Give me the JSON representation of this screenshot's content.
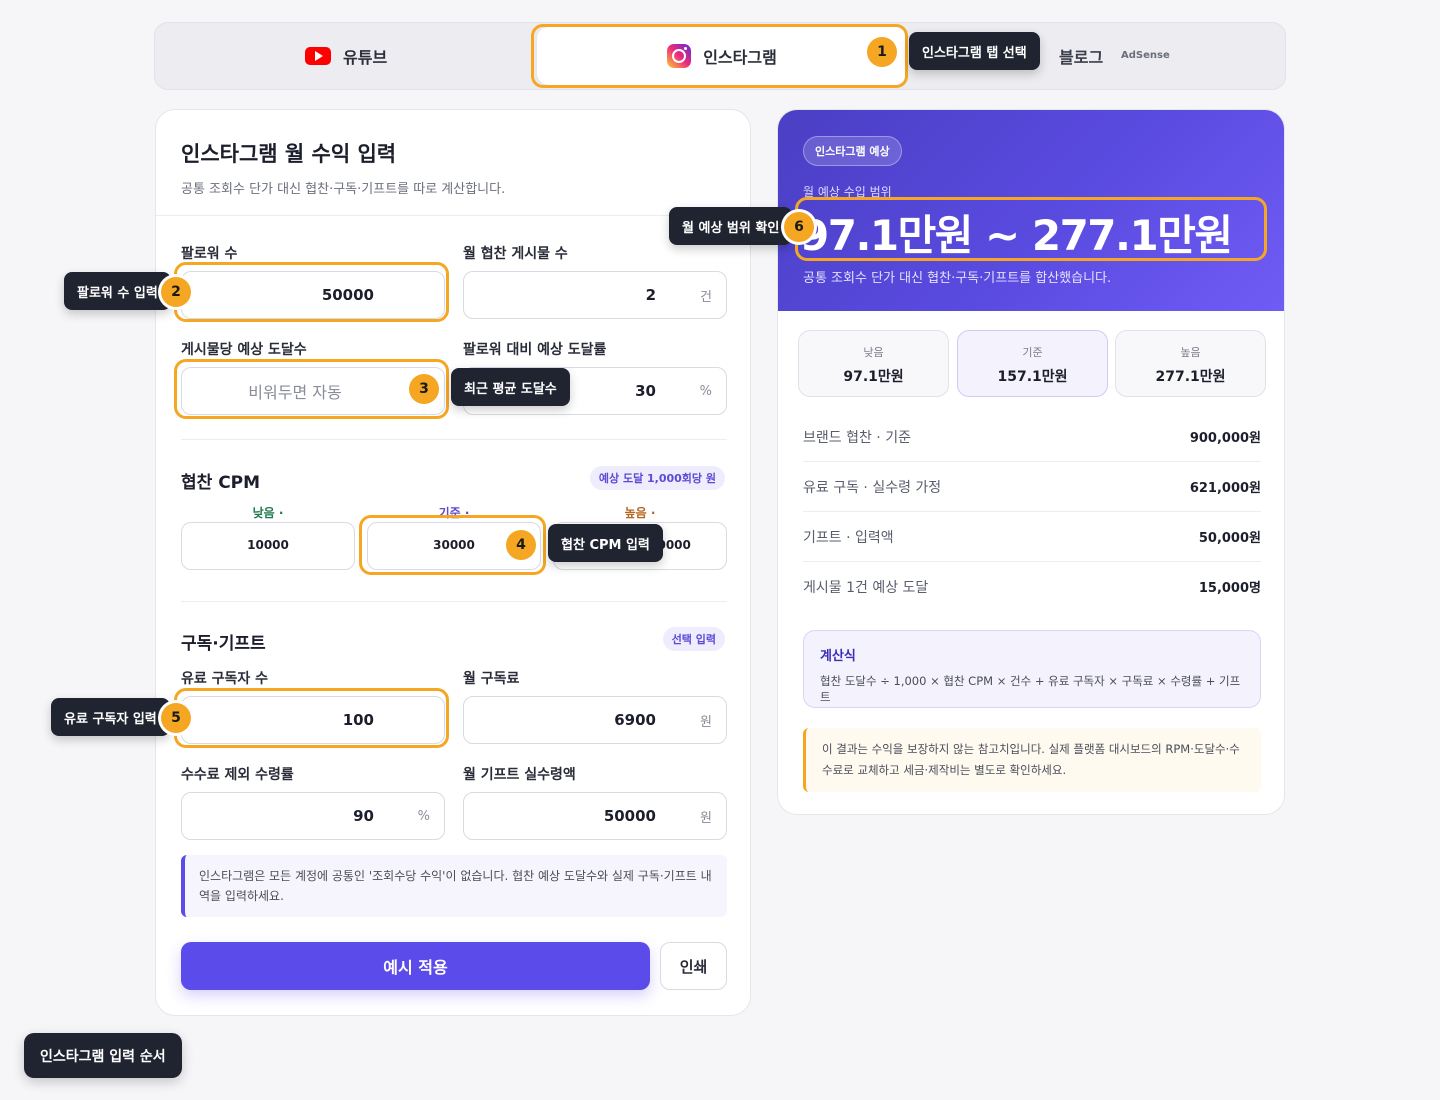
{
  "tabs": {
    "youtube": "유튜브",
    "instagram": "인스타그램",
    "blog": "블로그",
    "adsense": "AdSense"
  },
  "form": {
    "title": "인스타그램 월 수익 입력",
    "subtitle": "공통 조회수 단가 대신 협찬·구독·기프트를 따로 계산합니다.",
    "followers": {
      "label": "팔로워 수",
      "value": "50000"
    },
    "sponsored_posts": {
      "label": "월 협찬 게시물 수",
      "value": "2",
      "unit": "건"
    },
    "reach_per_post": {
      "label": "게시물당 예상 도달수",
      "placeholder": "비워두면 자동"
    },
    "reach_rate": {
      "label": "팔로워 대비 예상 도달률",
      "value": "30",
      "unit": "%"
    },
    "cpm": {
      "title": "협찬 CPM",
      "badge": "예상 도달 1,000회당 원",
      "low_label": "낮음 ·",
      "base_label": "기준 ·",
      "high_label": "높음 ·",
      "low": "10000",
      "base": "30000",
      "high": "70000"
    },
    "subs": {
      "title": "구독·기프트",
      "badge": "선택 입력",
      "paid_subs": {
        "label": "유료 구독자 수",
        "value": "100"
      },
      "monthly_fee": {
        "label": "월 구독료",
        "value": "6900",
        "unit": "원"
      },
      "net_rate": {
        "label": "수수료 제외 수령률",
        "value": "90",
        "unit": "%"
      },
      "gift": {
        "label": "월 기프트 실수령액",
        "value": "50000",
        "unit": "원"
      }
    },
    "note": "인스타그램은 모든 계정에 공통인 '조회수당 수익'이 없습니다. 협찬 예상 도달수와 실제 구독·기프트 내역을 입력하세요.",
    "apply_button": "예시 적용",
    "print_button": "인쇄"
  },
  "result": {
    "badge": "인스타그램 예상",
    "range_label": "월 예상 수입 범위",
    "range": "97.1만원 ~ 277.1만원",
    "range_desc": "공통 조회수 단가 대신 협찬·구독·기프트를 합산했습니다.",
    "tiers": [
      {
        "label": "낮음",
        "value": "97.1만원"
      },
      {
        "label": "기준",
        "value": "157.1만원"
      },
      {
        "label": "높음",
        "value": "277.1만원"
      }
    ],
    "rows": [
      {
        "label": "브랜드 협찬 · 기준",
        "value": "900,000원"
      },
      {
        "label": "유료 구독 · 실수령 가정",
        "value": "621,000원"
      },
      {
        "label": "기프트 · 입력액",
        "value": "50,000원"
      },
      {
        "label": "게시물 1건 예상 도달",
        "value": "15,000명"
      }
    ],
    "formula_title": "계산식",
    "formula": "협찬 도달수 ÷ 1,000 × 협찬 CPM × 건수 + 유료 구독자 × 구독료 × 수령률 + 기프트",
    "warning": "이 결과는 수익을 보장하지 않는 참고치입니다. 실제 플랫폼 대시보드의 RPM·도달수·수수료로 교체하고 세금·제작비는 별도로 확인하세요."
  },
  "guide": {
    "steps": [
      {
        "num": "1",
        "text": "인스타그램 탭 선택"
      },
      {
        "num": "2",
        "text": "팔로워 수 입력"
      },
      {
        "num": "3",
        "text": "최근 평균 도달수"
      },
      {
        "num": "4",
        "text": "협찬 CPM 입력"
      },
      {
        "num": "5",
        "text": "유료 구독자 입력"
      },
      {
        "num": "6",
        "text": "월 예상 범위 확인"
      }
    ],
    "title": "인스타그램 입력 순서"
  },
  "colors": {
    "accent": "#5b4bea",
    "highlight": "#f5a623",
    "tooltip_bg": "#1f2430"
  }
}
